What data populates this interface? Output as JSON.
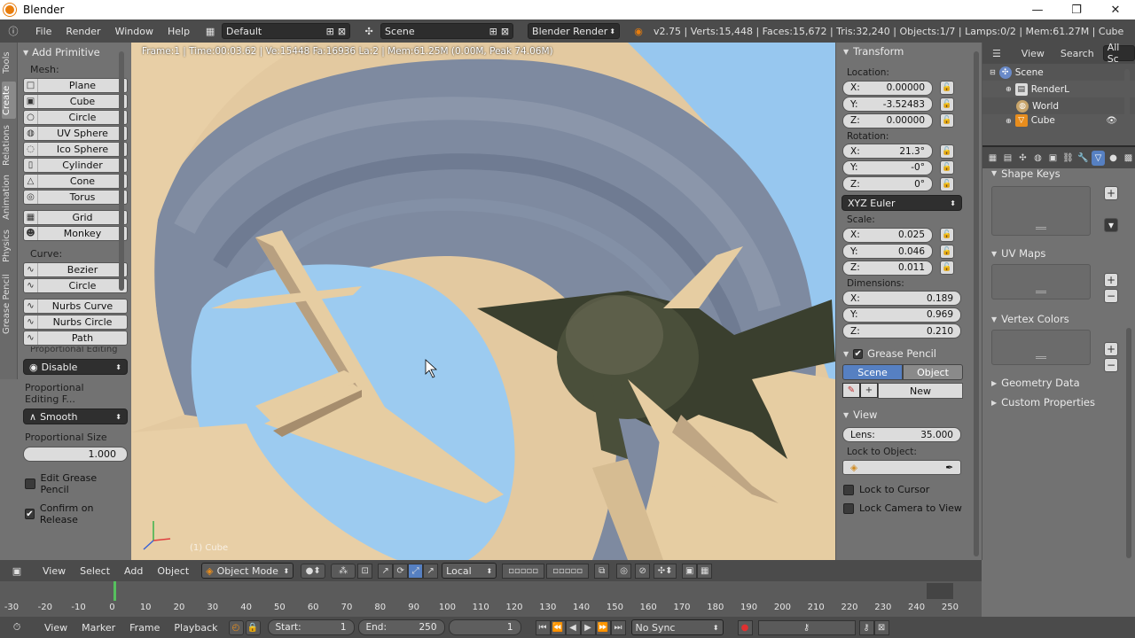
{
  "window": {
    "title": "Blender",
    "minimize": "—",
    "maximize": "❐",
    "close": "✕"
  },
  "info_header": {
    "menus": [
      "File",
      "Render",
      "Window",
      "Help"
    ],
    "layout": "Default",
    "scene": "Scene",
    "engine": "Blender Render",
    "stats": "v2.75 | Verts:15,448 | Faces:15,672 | Tris:32,240 | Objects:1/7 | Lamps:0/2 | Mem:61.27M | Cube"
  },
  "tool_tabs": [
    "Tools",
    "Create",
    "Relations",
    "Animation",
    "Physics",
    "Grease Pencil"
  ],
  "toolshelf": {
    "panel_title": "Add Primitive",
    "mesh_label": "Mesh:",
    "mesh": [
      {
        "label": "Plane",
        "icon": "□"
      },
      {
        "label": "Cube",
        "icon": "▣"
      },
      {
        "label": "Circle",
        "icon": "○"
      },
      {
        "label": "UV Sphere",
        "icon": "◍"
      },
      {
        "label": "Ico Sphere",
        "icon": "◌"
      },
      {
        "label": "Cylinder",
        "icon": "▯"
      },
      {
        "label": "Cone",
        "icon": "△"
      },
      {
        "label": "Torus",
        "icon": "◎"
      },
      {
        "label": "Grid",
        "icon": "▦"
      },
      {
        "label": "Monkey",
        "icon": "☻"
      }
    ],
    "curve_label": "Curve:",
    "curve": [
      {
        "label": "Bezier",
        "icon": "∿"
      },
      {
        "label": "Circle",
        "icon": "∿"
      },
      {
        "label": "Nurbs Curve",
        "icon": "∿"
      },
      {
        "label": "Nurbs Circle",
        "icon": "∿"
      },
      {
        "label": "Path",
        "icon": "∿"
      }
    ],
    "proportional_cut": "Proportional Editing",
    "proportional_value": "Disable",
    "prop_falloff_label": "Proportional Editing F...",
    "prop_falloff_value": "Smooth",
    "prop_size_label": "Proportional Size",
    "prop_size_value": "1.000",
    "edit_gp_label": "Edit Grease Pencil",
    "confirm_label": "Confirm on Release"
  },
  "viewport": {
    "info": "Frame:1 | Time:00:03.62 | Ve:15448 Fa:16936 La:2 | Mem:61.25M (0.00M, Peak 74.06M)",
    "object_label": "(1) Cube",
    "colors": {
      "sky": "#97c7ef",
      "sand": "#e8cfa6",
      "shadow": "#7e8a9c",
      "rocket": "#3d4330"
    }
  },
  "transform": {
    "title": "Transform",
    "location_label": "Location:",
    "location": [
      [
        "X:",
        "0.00000"
      ],
      [
        "Y:",
        "-3.52483"
      ],
      [
        "Z:",
        "0.00000"
      ]
    ],
    "rotation_label": "Rotation:",
    "rotation": [
      [
        "X:",
        "21.3°"
      ],
      [
        "Y:",
        "-0°"
      ],
      [
        "Z:",
        "0°"
      ]
    ],
    "rotation_mode": "XYZ Euler",
    "scale_label": "Scale:",
    "scale": [
      [
        "X:",
        "0.025"
      ],
      [
        "Y:",
        "0.046"
      ],
      [
        "Z:",
        "0.011"
      ]
    ],
    "dimensions_label": "Dimensions:",
    "dimensions": [
      [
        "X:",
        "0.189"
      ],
      [
        "Y:",
        "0.969"
      ],
      [
        "Z:",
        "0.210"
      ]
    ]
  },
  "grease_pencil": {
    "title": "Grease Pencil",
    "scene": "Scene",
    "object": "Object",
    "new": "New"
  },
  "view": {
    "title": "View",
    "lens_label": "Lens:",
    "lens_value": "35.000",
    "lock_obj_label": "Lock to Object:",
    "lock_cursor": "Lock to Cursor",
    "lock_camera": "Lock Camera to View"
  },
  "outliner": {
    "header_view": "View",
    "header_search": "Search",
    "header_all": "All Sc",
    "items": [
      {
        "label": "Scene",
        "indent": 0
      },
      {
        "label": "RenderL",
        "indent": 1
      },
      {
        "label": "World",
        "indent": 1
      },
      {
        "label": "Cube",
        "indent": 1
      }
    ]
  },
  "properties": {
    "shape_keys": "Shape Keys",
    "uv_maps": "UV Maps",
    "vertex_colors": "Vertex Colors",
    "geometry_data": "Geometry Data",
    "custom_properties": "Custom Properties"
  },
  "vp_header": {
    "menus": [
      "View",
      "Select",
      "Add",
      "Object"
    ],
    "mode": "Object Mode",
    "orientation": "Local"
  },
  "timeline": {
    "ticks": [
      "-30",
      "-20",
      "-10",
      "0",
      "10",
      "20",
      "30",
      "40",
      "50",
      "60",
      "70",
      "80",
      "90",
      "100",
      "110",
      "120",
      "130",
      "140",
      "150",
      "160",
      "170",
      "180",
      "190",
      "200",
      "210",
      "220",
      "230",
      "240",
      "250"
    ],
    "menus": [
      "View",
      "Marker",
      "Frame",
      "Playback"
    ],
    "start_label": "Start:",
    "start": "1",
    "end_label": "End:",
    "end": "250",
    "current": "1",
    "sync": "No Sync"
  }
}
